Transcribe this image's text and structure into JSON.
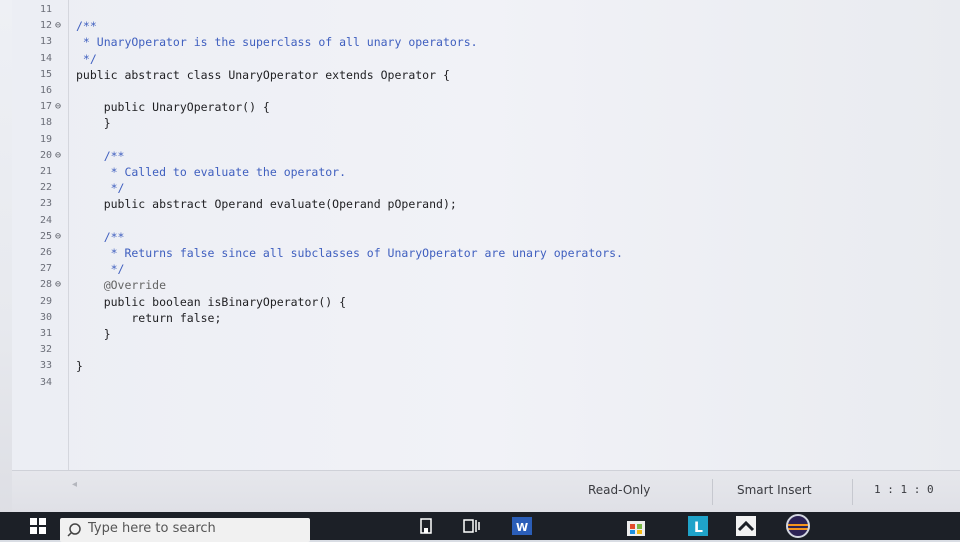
{
  "editor": {
    "lines": [
      {
        "num": "11",
        "fold": "",
        "code": ""
      },
      {
        "num": "12",
        "fold": "⊖",
        "code": "/**"
      },
      {
        "num": "13",
        "fold": "",
        "code": " * UnaryOperator is the superclass of all unary operators."
      },
      {
        "num": "14",
        "fold": "",
        "code": " */"
      },
      {
        "num": "15",
        "fold": "",
        "code": "public abstract class UnaryOperator extends Operator {"
      },
      {
        "num": "16",
        "fold": "",
        "code": ""
      },
      {
        "num": "17",
        "fold": "⊖",
        "code": "    public UnaryOperator() {"
      },
      {
        "num": "18",
        "fold": "",
        "code": "    }"
      },
      {
        "num": "19",
        "fold": "",
        "code": ""
      },
      {
        "num": "20",
        "fold": "⊖",
        "code": "    /**"
      },
      {
        "num": "21",
        "fold": "",
        "code": "     * Called to evaluate the operator."
      },
      {
        "num": "22",
        "fold": "",
        "code": "     */"
      },
      {
        "num": "23",
        "fold": "",
        "code": "    public abstract Operand evaluate(Operand pOperand);"
      },
      {
        "num": "24",
        "fold": "",
        "code": ""
      },
      {
        "num": "25",
        "fold": "⊖",
        "code": "    /**"
      },
      {
        "num": "26",
        "fold": "",
        "code": "     * Returns false since all subclasses of UnaryOperator are unary operators."
      },
      {
        "num": "27",
        "fold": "",
        "code": "     */"
      },
      {
        "num": "28",
        "fold": "⊖",
        "code": "    @Override"
      },
      {
        "num": "29",
        "fold": "",
        "code": "    public boolean isBinaryOperator() {"
      },
      {
        "num": "30",
        "fold": "",
        "code": "        return false;"
      },
      {
        "num": "31",
        "fold": "",
        "code": "    }"
      },
      {
        "num": "32",
        "fold": "",
        "code": ""
      },
      {
        "num": "33",
        "fold": "",
        "code": "}"
      },
      {
        "num": "34",
        "fold": "",
        "code": ""
      }
    ]
  },
  "status": {
    "mode": "Read-Only",
    "insert": "Smart Insert",
    "position": "1 : 1 : 0"
  },
  "taskbar": {
    "search_placeholder": "Type here to search",
    "icons": [
      "windows-start-icon",
      "search-icon",
      "file-explorer-icon",
      "task-view-icon",
      "word-icon",
      "store-icon",
      "l-app-icon",
      "mail-icon",
      "eclipse-icon"
    ]
  }
}
